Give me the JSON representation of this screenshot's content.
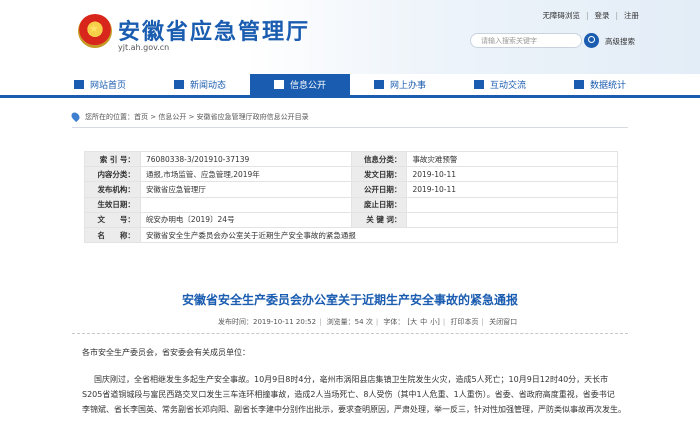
{
  "header": {
    "site_title": "安徽省应急管理厅",
    "domain": "yjt.ah.gov.cn",
    "top_links": [
      "无障碍浏览",
      "登录",
      "注册"
    ],
    "search_placeholder": "请输入搜索关键字",
    "advanced_search": "高级搜索"
  },
  "nav": {
    "items": [
      {
        "label": "网站首页",
        "icon": "home-icon"
      },
      {
        "label": "新闻动态",
        "icon": "news-icon"
      },
      {
        "label": "信息公开",
        "icon": "document-icon",
        "active": true
      },
      {
        "label": "网上办事",
        "icon": "monitor-icon"
      },
      {
        "label": "互动交流",
        "icon": "chat-icon"
      },
      {
        "label": "数据统计",
        "icon": "chart-icon"
      }
    ]
  },
  "breadcrumb": {
    "prefix": "您所在的位置：",
    "items": [
      "首页",
      "信息公开",
      "安徽省应急管理厅政府信息公开目录"
    ]
  },
  "info": {
    "index_label": "索 引 号：",
    "index_value": "76080338-3/201910-37139",
    "category_label": "信息分类：",
    "category_value": "事故灾难预警",
    "content_label": "内容分类：",
    "content_value": "通报,市场监管、应急管理,2019年",
    "date_label": "发文日期：",
    "date_value": "2019-10-11",
    "org_label": "发布机构：",
    "org_value": "安徽省应急管理厅",
    "pub_label": "公开日期：",
    "pub_value": "2019-10-11",
    "effective_label": "生效日期：",
    "effective_value": "",
    "abolish_label": "废止日期：",
    "abolish_value": "",
    "docno_label": "文　　号：",
    "docno_value": "皖安办明电〔2019〕24号",
    "keyword_label": "关 键 词：",
    "keyword_value": "",
    "name_label": "名　　称：",
    "name_value": "安徽省安全生产委员会办公室关于近期生产安全事故的紧急通报"
  },
  "article": {
    "title": "安徽省安全生产委员会办公室关于近期生产安全事故的紧急通报",
    "meta": {
      "published": "发布时间：2019-10-11 20:52",
      "views": "浏览量：54 次",
      "font_label": "字体：",
      "font_big": "[大",
      "font_mid": "中",
      "font_small": "小]",
      "print": "打印本页",
      "close": "关闭窗口"
    },
    "salutation": "各市安全生产委员会，省安委会有关成员单位：",
    "line1": "国庆刚过，全省相继发生多起生产安全事故。10月9日8时4分，亳州市涡阳县店集镇卫生院发生火灾，造成5人死亡；10月9日12时40分，天长市",
    "line2": "S205省道铜城段与富民西路交叉口发生三车连环相撞事故，造成2人当场死亡、8人受伤（其中1人危重、1人重伤）。省委、省政府高度重视，省委书记",
    "line3": "李锦斌、省长李国英、常务副省长邓向阳、副省长李建中分别作出批示，要求查明原因，严肃处理，举一反三，针对性加强管理，严防类似事故再次发生。"
  },
  "colors": {
    "brand_blue": "#1a5cb0",
    "label_bg": "#ececec"
  }
}
